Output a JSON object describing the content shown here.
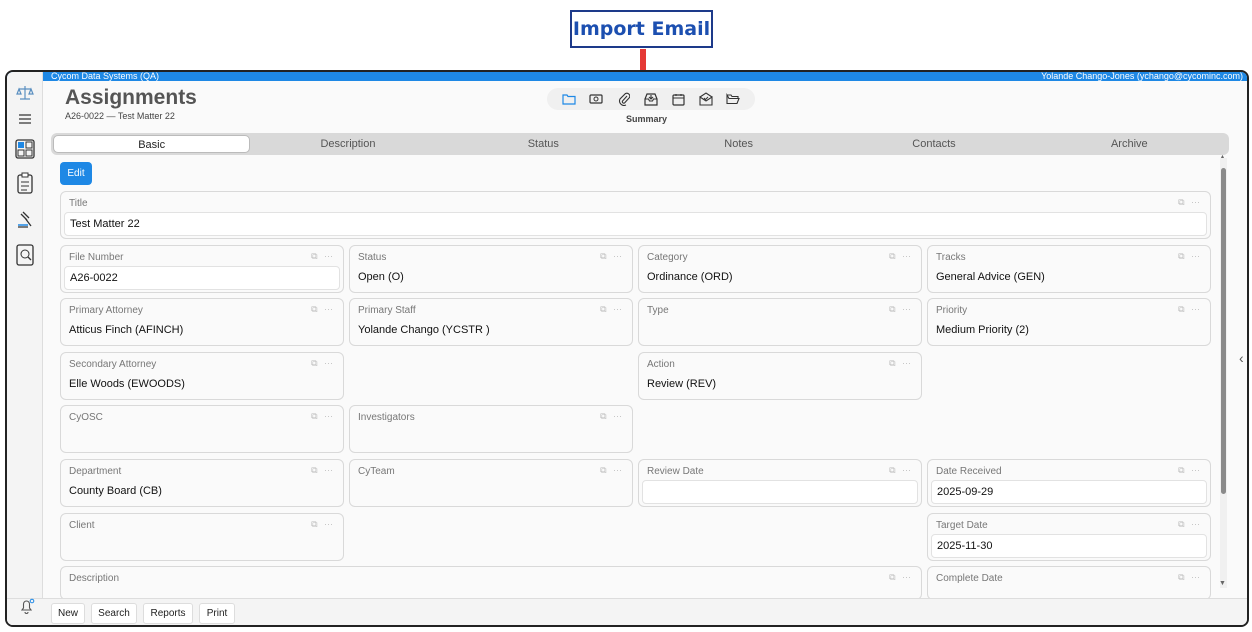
{
  "annotation": {
    "label": "Import Email"
  },
  "topbar": {
    "org": "Cycom Data Systems (QA)",
    "user": "Yolande Chango-Jones (ychango@cycominc.com)"
  },
  "header": {
    "title": "Assignments",
    "subtitle": "A26-0022 — Test Matter 22"
  },
  "toolbar": {
    "icons": [
      "folder-icon",
      "money-icon",
      "paperclip-icon",
      "import-email-icon",
      "calendar-icon",
      "mail-check-icon",
      "folder-open-icon"
    ],
    "label": "Summary"
  },
  "tabs": [
    "Basic",
    "Description",
    "Status",
    "Notes",
    "Contacts",
    "Archive"
  ],
  "active_tab": "Basic",
  "edit_label": "Edit",
  "fields": {
    "title": {
      "label": "Title",
      "value": "Test Matter 22"
    },
    "file_number": {
      "label": "File Number",
      "value": "A26-0022"
    },
    "status": {
      "label": "Status",
      "value": "Open (O)"
    },
    "category": {
      "label": "Category",
      "value": "Ordinance (ORD)"
    },
    "tracks": {
      "label": "Tracks",
      "value": "General Advice (GEN)"
    },
    "primary_attorney": {
      "label": "Primary Attorney",
      "value": "Atticus Finch (AFINCH)"
    },
    "primary_staff": {
      "label": "Primary Staff",
      "value": "Yolande Chango (YCSTR )"
    },
    "type": {
      "label": "Type",
      "value": ""
    },
    "priority": {
      "label": "Priority",
      "value": "Medium Priority (2)"
    },
    "secondary_attorney": {
      "label": "Secondary Attorney",
      "value": "Elle Woods (EWOODS)"
    },
    "action": {
      "label": "Action",
      "value": "Review (REV)"
    },
    "cyosc": {
      "label": "CyOSC",
      "value": ""
    },
    "investigators": {
      "label": "Investigators",
      "value": ""
    },
    "department": {
      "label": "Department",
      "value": "County Board (CB)"
    },
    "cyteam": {
      "label": "CyTeam",
      "value": ""
    },
    "review_date": {
      "label": "Review Date",
      "value": ""
    },
    "date_received": {
      "label": "Date Received",
      "value": "2025-09-29"
    },
    "client": {
      "label": "Client",
      "value": ""
    },
    "target_date": {
      "label": "Target Date",
      "value": "2025-11-30"
    },
    "description": {
      "label": "Description",
      "value": ""
    },
    "complete_date": {
      "label": "Complete Date",
      "value": ""
    }
  },
  "bottombar": {
    "new": "New",
    "search": "Search",
    "reports": "Reports",
    "print": "Print"
  },
  "colors": {
    "accent": "#1e88e5",
    "annotation_arrow": "#e53935",
    "annotation_text": "#1c4fb0"
  }
}
